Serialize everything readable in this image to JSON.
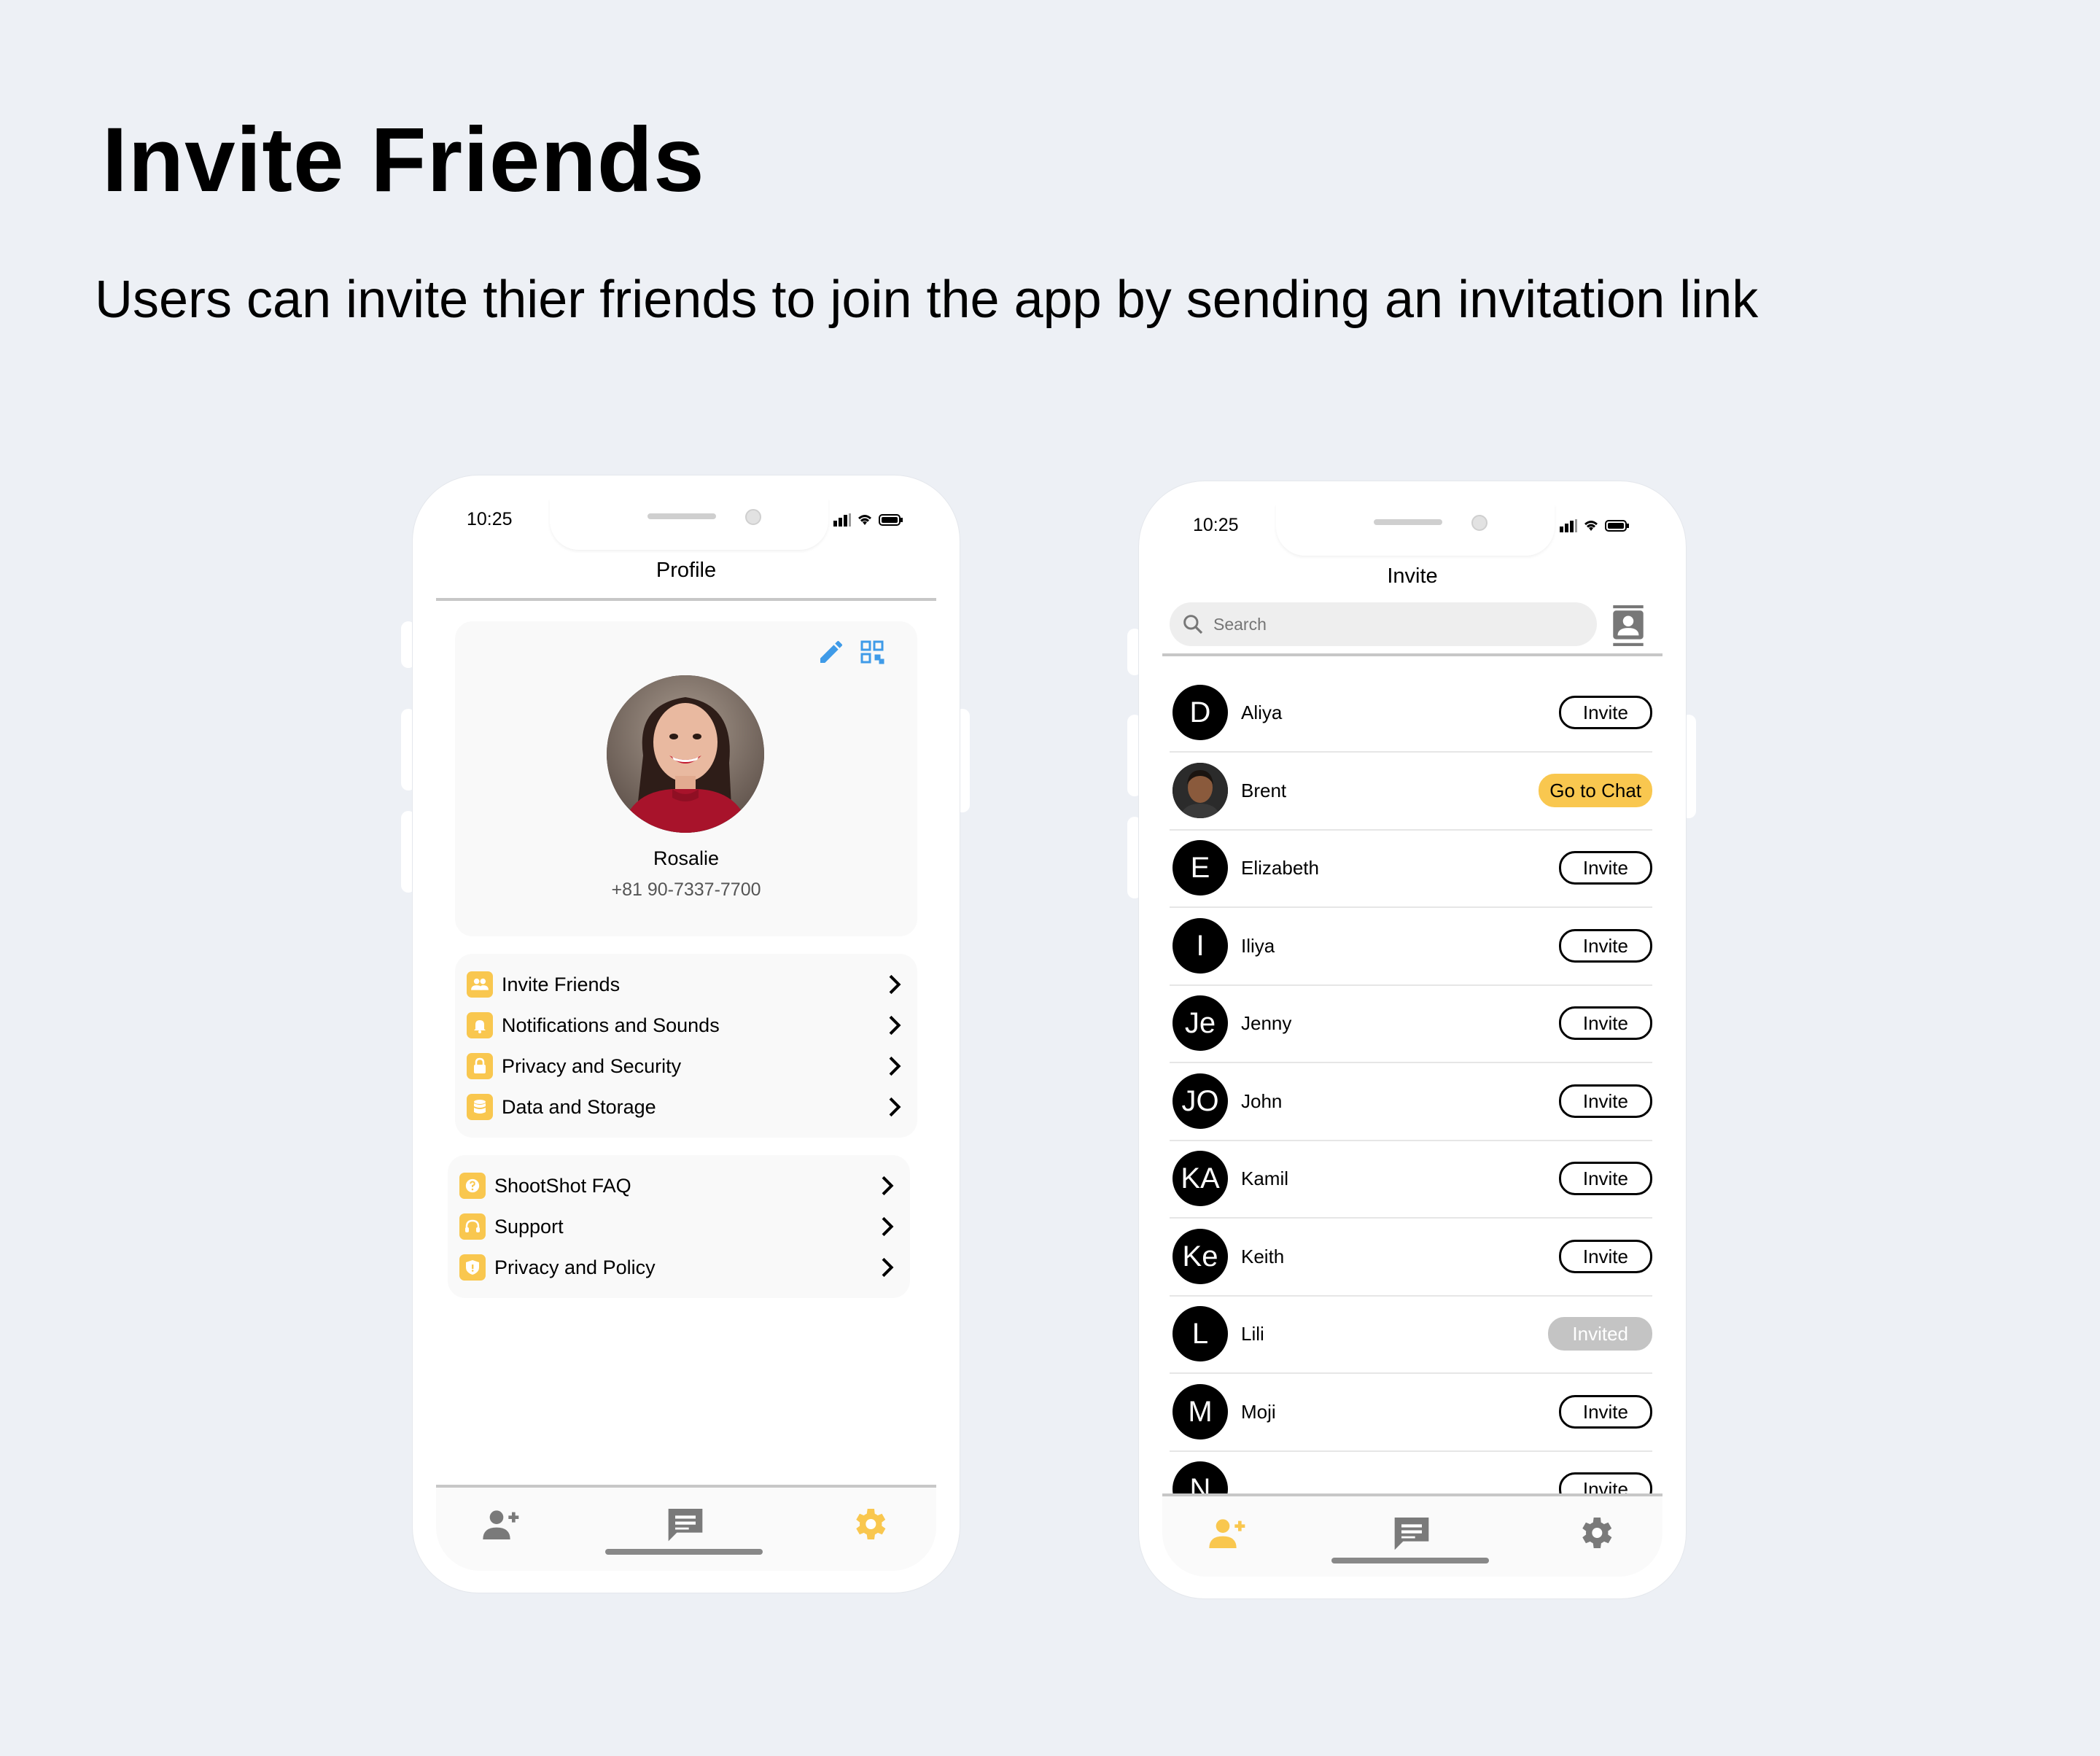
{
  "page": {
    "heading": "Invite Friends",
    "subheading": "Users can invite thier friends to join the app by sending an invitation link"
  },
  "colors": {
    "accent": "#f9c74f",
    "background": "#edf0f5",
    "blue_icon": "#3f9be8",
    "tab_inactive": "#7a7a7a"
  },
  "profile_screen": {
    "status_time": "10:25",
    "title": "Profile",
    "user_name": "Rosalie",
    "user_phone": "+81 90-7337-7700",
    "settings_items": [
      {
        "label": "Invite Friends",
        "icon": "friends-icon"
      },
      {
        "label": "Notifications and Sounds",
        "icon": "bell-icon"
      },
      {
        "label": "Privacy and Security",
        "icon": "lock-icon"
      },
      {
        "label": "Data and Storage",
        "icon": "database-icon"
      }
    ],
    "help_items": [
      {
        "label": "ShootShot FAQ",
        "icon": "question-icon"
      },
      {
        "label": "Support",
        "icon": "headset-icon"
      },
      {
        "label": "Privacy and Policy",
        "icon": "shield-icon"
      }
    ],
    "active_tab": "settings"
  },
  "invite_screen": {
    "status_time": "10:25",
    "title": "Invite",
    "search_placeholder": "Search",
    "contacts": [
      {
        "initials": "D",
        "name": "Aliya",
        "action": "Invite"
      },
      {
        "initials": "",
        "name": "Brent",
        "action": "Go to Chat",
        "photo": true
      },
      {
        "initials": "E",
        "name": "Elizabeth",
        "action": "Invite"
      },
      {
        "initials": "I",
        "name": "Iliya",
        "action": "Invite"
      },
      {
        "initials": "Je",
        "name": "Jenny",
        "action": "Invite"
      },
      {
        "initials": "JO",
        "name": "John",
        "action": "Invite"
      },
      {
        "initials": "KA",
        "name": "Kamil",
        "action": "Invite"
      },
      {
        "initials": "Ke",
        "name": "Keith",
        "action": "Invite"
      },
      {
        "initials": "L",
        "name": "Lili",
        "action": "Invited"
      },
      {
        "initials": "M",
        "name": "Moji",
        "action": "Invite"
      },
      {
        "initials": "N",
        "name": "",
        "action": "Invite"
      }
    ],
    "active_tab": "add-friend"
  }
}
